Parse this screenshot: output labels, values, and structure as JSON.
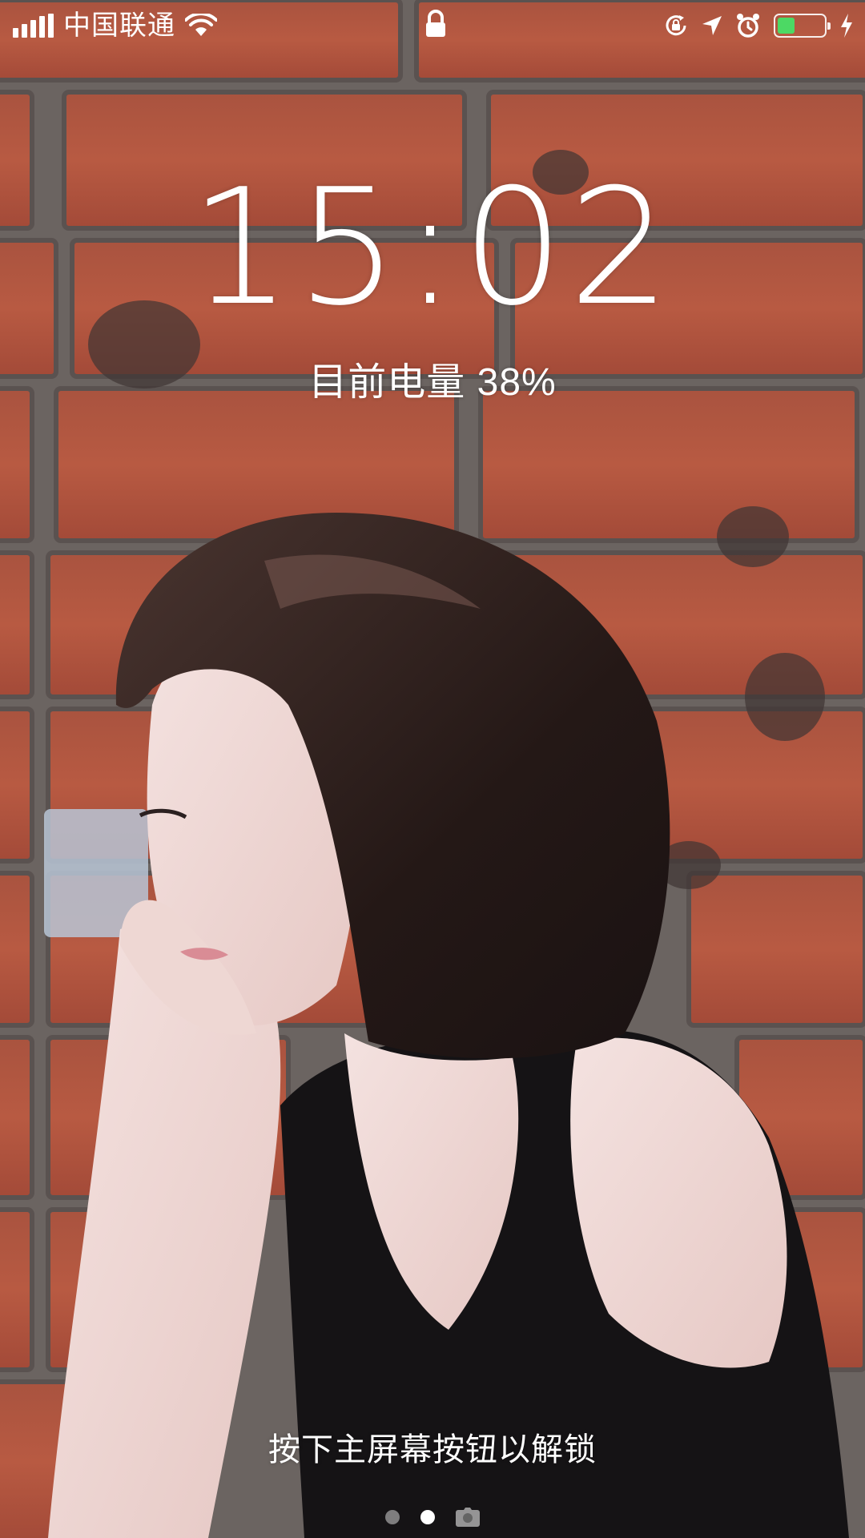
{
  "status_bar": {
    "carrier": "中国联通",
    "icons": [
      "signal-icon",
      "wifi-icon",
      "lock-icon",
      "rotation-lock-icon",
      "location-icon",
      "alarm-icon",
      "battery-icon",
      "charging-icon"
    ],
    "battery_level": 0.38,
    "battery_color": "#4cd964"
  },
  "lock_screen": {
    "time": "15:02",
    "battery_status": "目前电量 38%",
    "unlock_hint": "按下主屏幕按钮以解锁"
  },
  "page_indicator": {
    "pages": 3,
    "active_index": 1,
    "icons": [
      "dot",
      "dot",
      "camera-icon"
    ]
  },
  "wallpaper": {
    "subject": "woman-portrait-brick-wall",
    "colors": {
      "brick": "#b5533b",
      "mortar": "#6e6a68",
      "hair": "#2a1d1a",
      "dress": "#141214",
      "skin": "#efd3cf"
    }
  }
}
